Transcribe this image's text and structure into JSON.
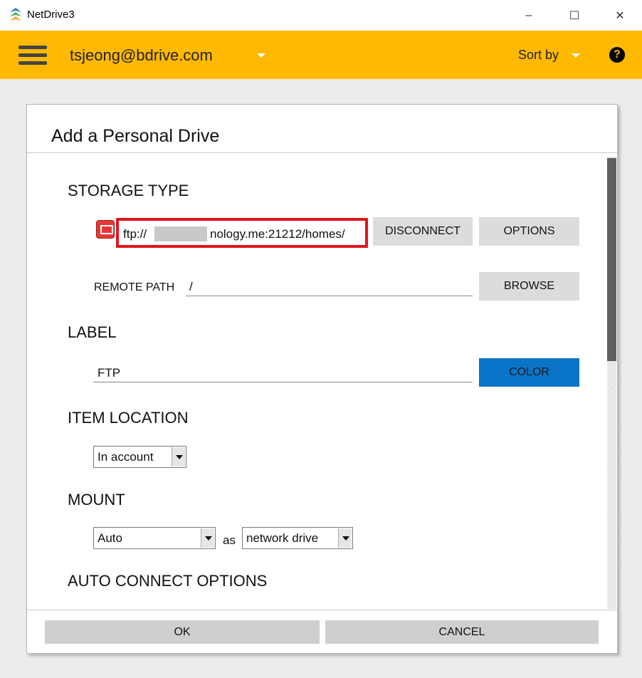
{
  "window": {
    "title": "NetDrive3",
    "controls": {
      "minimize": "–",
      "maximize": "☐",
      "close": "✕"
    }
  },
  "header": {
    "account": "tsjeong@bdrive.com",
    "sort_label": "Sort by",
    "help": "?",
    "accent_color": "#FFB900"
  },
  "dialog": {
    "title": "Add a Personal Drive",
    "storage": {
      "heading": "STORAGE TYPE",
      "url_prefix": "ftp://",
      "url_suffix": "nology.me:21212/homes/",
      "disconnect_label": "DISCONNECT",
      "options_label": "OPTIONS",
      "remote_path_label": "REMOTE PATH",
      "remote_path_value": "/",
      "browse_label": "BROWSE"
    },
    "label": {
      "heading": "LABEL",
      "value": "FTP",
      "color_label": "COLOR",
      "color": "#0A74C8"
    },
    "item_location": {
      "heading": "ITEM LOCATION",
      "selected": "In account"
    },
    "mount": {
      "heading": "MOUNT",
      "drive_selected": "Auto",
      "as_label": "as",
      "type_selected": "network drive"
    },
    "auto_connect": {
      "heading": "AUTO CONNECT OPTIONS"
    },
    "footer": {
      "ok_label": "OK",
      "cancel_label": "CANCEL"
    }
  }
}
